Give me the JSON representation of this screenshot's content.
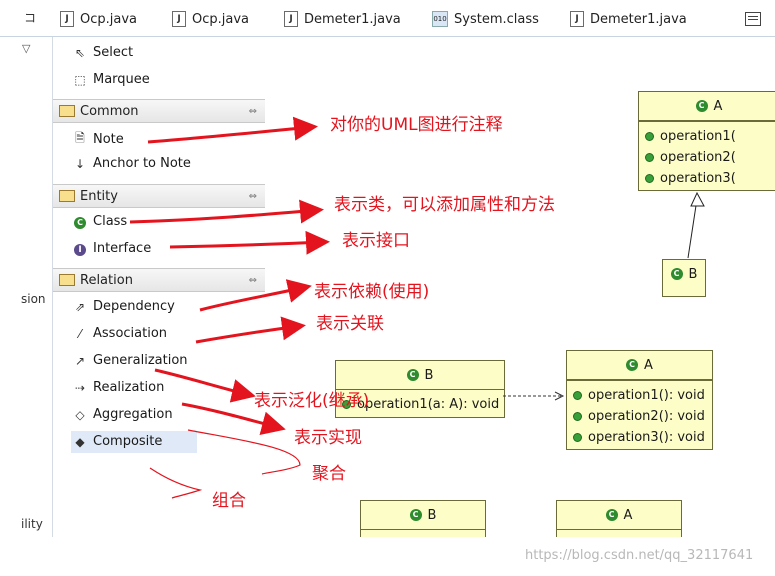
{
  "tabs": [
    {
      "label": "Ocp.java",
      "icon": "java-file-icon"
    },
    {
      "label": "Ocp.java",
      "icon": "java-file-icon"
    },
    {
      "label": "Demeter1.java",
      "icon": "java-file-icon"
    },
    {
      "label": "System.class",
      "icon": "class-file-icon"
    },
    {
      "label": "Demeter1.java",
      "icon": "java-file-icon"
    }
  ],
  "left_strip": {
    "top_glyph": "コ",
    "word1": "sion",
    "word2": "ility"
  },
  "palette": {
    "tools": [
      {
        "label": "Select"
      },
      {
        "label": "Marquee"
      }
    ],
    "drawers": [
      {
        "label": "Common",
        "items": [
          {
            "label": "Note"
          },
          {
            "label": "Anchor to Note"
          }
        ]
      },
      {
        "label": "Entity",
        "items": [
          {
            "label": "Class"
          },
          {
            "label": "Interface"
          }
        ]
      },
      {
        "label": "Relation",
        "items": [
          {
            "label": "Dependency"
          },
          {
            "label": "Association"
          },
          {
            "label": "Generalization"
          },
          {
            "label": "Realization"
          },
          {
            "label": "Aggregation"
          },
          {
            "label": "Composite"
          }
        ]
      }
    ]
  },
  "diagram": {
    "classA_top": {
      "name": "A",
      "ops": [
        "operation1(",
        "operation2(",
        "operation3("
      ]
    },
    "classB_small": {
      "name": "B"
    },
    "classB_mid": {
      "name": "B",
      "ops": [
        "operation1(a: A): void"
      ]
    },
    "classA_mid": {
      "name": "A",
      "ops": [
        "operation1(): void",
        "operation2(): void",
        "operation3(): void"
      ]
    },
    "classB_bottom": {
      "name": "B"
    },
    "classA_bottom": {
      "name": "A"
    }
  },
  "annotations": {
    "note": "对你的UML图进行注释",
    "class": "表示类，可以添加属性和方法",
    "interface": "表示接口",
    "dependency": "表示依赖(使用)",
    "association": "表示关联",
    "generalization": "表示泛化(继承)",
    "realization": "表示实现",
    "aggregation": "聚合",
    "composite": "组合"
  },
  "colors": {
    "annotation": "#e3141e",
    "class_fill": "#fdfdc8",
    "class_border": "#6b6b3a",
    "selected": "#dfe9f7"
  },
  "watermark": "https://blog.csdn.net/qq_32117641"
}
